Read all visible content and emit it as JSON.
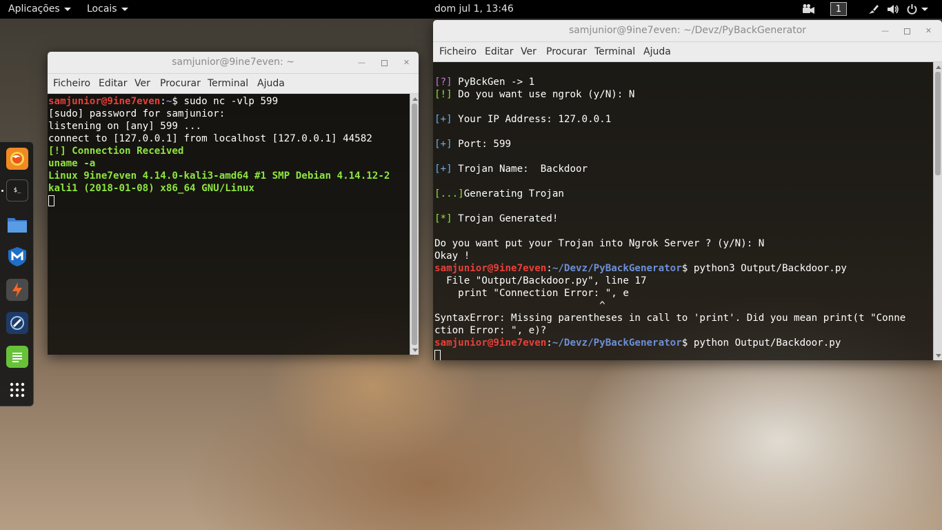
{
  "topbar": {
    "applications": "Aplicações",
    "places": "Locais",
    "clock": "dom jul  1, 13:46",
    "workspace": "1"
  },
  "dock": {
    "items": [
      "firefox-icon",
      "terminal-icon",
      "files-icon",
      "metasploit-icon",
      "burpsuite-icon",
      "armitage-icon",
      "text-editor-icon",
      "show-apps-icon"
    ]
  },
  "window_left": {
    "title": "samjunior@9ine7even: ~",
    "menu": [
      "Ficheiro",
      "Editar",
      "Ver",
      "Procurar",
      "Terminal",
      "Ajuda"
    ],
    "lines": [
      {
        "user": "samjunior@9ine7even",
        "path": "~",
        "cmd": "$ sudo nc -vlp 599"
      },
      {
        "text": "[sudo] password for samjunior:"
      },
      {
        "text": "listening on [any] 599 ..."
      },
      {
        "text": "connect to [127.0.0.1] from localhost [127.0.0.1] 44582"
      },
      {
        "green": "[!] Connection Received"
      },
      {
        "green": "uname -a"
      },
      {
        "green": "Linux 9ine7even 4.14.0-kali3-amd64 #1 SMP Debian 4.14.12-2"
      },
      {
        "green": "kali1 (2018-01-08) x86_64 GNU/Linux"
      }
    ]
  },
  "window_right": {
    "title": "samjunior@9ine7even: ~/Devz/PyBackGenerator",
    "menu": [
      "Ficheiro",
      "Editar",
      "Ver",
      "Procurar",
      "Terminal",
      "Ajuda"
    ],
    "lines": {
      "l1_tag": "[?]",
      "l1_text": " PyBckGen -> 1",
      "l2_tag": "[!]",
      "l2_text": " Do you want use ngrok (y/N): N",
      "l3_tag": "[+]",
      "l3_text": " Your IP Address: 127.0.0.1",
      "l4_tag": "[+]",
      "l4_text": " Port: 599",
      "l5_tag": "[+]",
      "l5_text": " Trojan Name:  Backdoor",
      "l6_tag": "[...]",
      "l6_text": "Generating Trojan",
      "l7_tag": "[*]",
      "l7_text": " Trojan Generated!",
      "l8": "Do you want put your Trojan into Ngrok Server ? (y/N): N",
      "l9": "Okay !",
      "l10_user": "samjunior@9ine7even",
      "l10_colon": ":",
      "l10_path": "~/Devz/PyBackGenerator",
      "l10_cmd": "$ python3 Output/Backdoor.py",
      "l11": "  File \"Output/Backdoor.py\", line 17",
      "l12": "    print \"Connection Error: \", e",
      "l13": "                            ^",
      "l14": "SyntaxError: Missing parentheses in call to 'print'. Did you mean print(t \"Conne",
      "l15": "ction Error: \", e)?",
      "l16_user": "samjunior@9ine7even",
      "l16_colon": ":",
      "l16_path": "~/Devz/PyBackGenerator",
      "l16_cmd": "$ python Output/Backdoor.py"
    }
  }
}
